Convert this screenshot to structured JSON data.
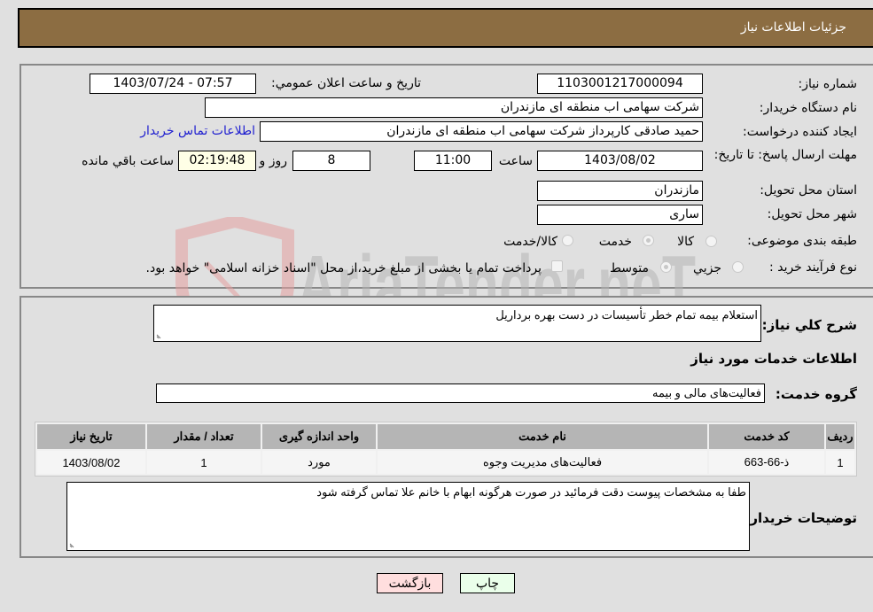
{
  "header": {
    "title": "جزئیات اطلاعات نیاز"
  },
  "form": {
    "need_number": {
      "label": "شماره نیاز:",
      "value": "1103001217000094"
    },
    "announce_datetime": {
      "label": "تاریخ و ساعت اعلان عمومي:",
      "value": "1403/07/24 - 07:57"
    },
    "buyer_org": {
      "label": "نام دستگاه خریدار:",
      "value": "شرکت سهامی اب منطقه ای مازندران"
    },
    "requester": {
      "label": "ایجاد کننده درخواست:",
      "value": "حمید  صادقی کارپرداز شرکت سهامی اب منطقه ای مازندران"
    },
    "buyer_contact_link": "اطلاعات تماس خریدار",
    "deadline": {
      "label": "مهلت ارسال پاسخ: تا تاریخ:",
      "date": "1403/08/02",
      "time_label": "ساعت",
      "time": "11:00",
      "days": "8",
      "days_label": "روز و",
      "remaining": "02:19:48",
      "remaining_label": "ساعت باقي مانده"
    },
    "delivery_province": {
      "label": "استان محل تحویل:",
      "value": "مازندران"
    },
    "delivery_city": {
      "label": "شهر محل تحویل:",
      "value": "ساری"
    },
    "category": {
      "label": "طبقه بندی موضوعی:",
      "options": [
        "کالا",
        "خدمت",
        "کالا/خدمت"
      ],
      "selected": "خدمت"
    },
    "purchase_type": {
      "label": "نوع فرآیند خرید :",
      "options": [
        "جزيي",
        "متوسط"
      ],
      "selected": "متوسط",
      "treasury_note": "پرداخت تمام یا بخشی از مبلغ خرید،از محل \"اسناد خزانه اسلامی\" خواهد بود.",
      "treasury_checked": false
    }
  },
  "details": {
    "summary_label": "شرح کلي نیاز:",
    "summary_value": "استعلام بیمه تمام خطر تأسیسات در دست بهره برداریل",
    "services_heading": "اطلاعات خدمات مورد نیاز",
    "service_group_label": "گروه خدمت:",
    "service_group_value": "فعالیت‌های مالی و بیمه",
    "table": {
      "headers": [
        "ردیف",
        "کد خدمت",
        "نام خدمت",
        "واحد اندازه گیری",
        "تعداد / مقدار",
        "تاریخ نیاز"
      ],
      "rows": [
        [
          "1",
          "ذ-66-663",
          "فعالیت‌های مدیریت وجوه",
          "مورد",
          "1",
          "1403/08/02"
        ]
      ]
    },
    "buyer_notes_label": "توضیحات خریدار:",
    "buyer_notes_value": "طفا به مشخصات پیوست دقت فرمائید در صورت هرگونه ابهام با خانم علا تماس گرفته شود"
  },
  "buttons": {
    "print": "چاپ",
    "back": "بازگشت"
  },
  "watermark": {
    "text": "AriaTender.neT"
  },
  "colors": {
    "header_bg": "#8c6d42",
    "print_bg": "#eaffea",
    "back_bg": "#ffdede",
    "link": "#2020d0"
  }
}
